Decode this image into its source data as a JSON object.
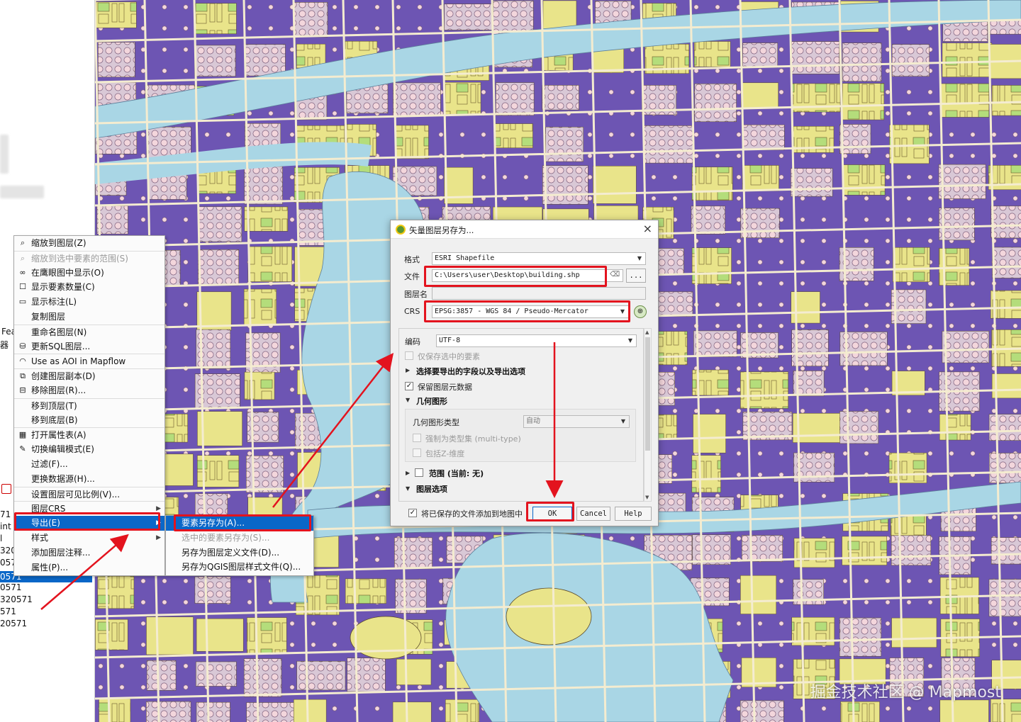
{
  "left_panel": {
    "fragments": [
      "Fea",
      "器",
      "71",
      "int",
      "l",
      "320",
      "0571",
      "0571",
      "0571",
      "320571",
      "571",
      "20571"
    ]
  },
  "context_menu": {
    "items": [
      {
        "label": "缩放到图层(Z)",
        "icon": "magnifier-icon",
        "disabled": false
      },
      {
        "label": "缩放到选中要素的范围(S)",
        "icon": "magnifier-icon",
        "disabled": true
      },
      {
        "label": "在鹰眼图中显示(O)",
        "icon": "binoculars-icon",
        "disabled": false
      },
      {
        "label": "显示要素数量(C)",
        "icon": "checkbox-icon",
        "disabled": false
      },
      {
        "label": "显示标注(L)",
        "icon": "label-icon",
        "disabled": false
      },
      {
        "label": "复制图层",
        "icon": "",
        "disabled": false
      },
      {
        "label": "重命名图层(N)",
        "icon": "",
        "disabled": false
      },
      {
        "label": "更新SQL图层...",
        "icon": "database-icon",
        "disabled": false
      },
      {
        "label": "Use as AOI in Mapflow",
        "icon": "mapflow-icon",
        "disabled": false
      },
      {
        "label": "创建图层副本(D)",
        "icon": "duplicate-icon",
        "disabled": false
      },
      {
        "label": "移除图层(R)...",
        "icon": "remove-layer-icon",
        "disabled": false
      },
      {
        "label": "移到顶层(T)",
        "icon": "",
        "disabled": false
      },
      {
        "label": "移到底层(B)",
        "icon": "",
        "disabled": false
      },
      {
        "label": "打开属性表(A)",
        "icon": "table-icon",
        "disabled": false
      },
      {
        "label": "切换编辑模式(E)",
        "icon": "pencil-icon",
        "disabled": false
      },
      {
        "label": "过滤(F)...",
        "icon": "",
        "disabled": false
      },
      {
        "label": "更换数据源(H)...",
        "icon": "",
        "disabled": false
      },
      {
        "label": "设置图层可见比例(V)...",
        "icon": "",
        "disabled": false
      },
      {
        "label": "图层CRS",
        "icon": "",
        "disabled": false,
        "submenu": true
      },
      {
        "label": "导出(E)",
        "icon": "",
        "disabled": false,
        "submenu": true,
        "highlighted": true
      },
      {
        "label": "样式",
        "icon": "",
        "disabled": false,
        "submenu": true
      },
      {
        "label": "添加图层注释...",
        "icon": "",
        "disabled": false
      },
      {
        "label": "属性(P)...",
        "icon": "",
        "disabled": false
      }
    ]
  },
  "export_submenu": {
    "items": [
      {
        "label": "要素另存为(A)...",
        "highlighted": true,
        "disabled": false
      },
      {
        "label": "选中的要素另存为(S)...",
        "highlighted": false,
        "disabled": true
      },
      {
        "label": "另存为图层定义文件(D)...",
        "highlighted": false,
        "disabled": false
      },
      {
        "label": "另存为QGIS图层样式文件(Q)...",
        "highlighted": false,
        "disabled": false
      }
    ]
  },
  "dialog": {
    "title": "矢量图层另存为...",
    "close": "×",
    "format_label": "格式",
    "format_value": "ESRI Shapefile",
    "file_label": "文件",
    "file_value": "C:\\Users\\user\\Desktop\\building.shp",
    "browse_label": "...",
    "layer_name_label": "图层名",
    "layer_name_value": "",
    "crs_label": "CRS",
    "crs_value": "EPSG:3857 - WGS 84 / Pseudo-Mercator",
    "encoding_label": "编码",
    "encoding_value": "UTF-8",
    "only_selected_label": "仅保存选中的要素",
    "fields_section": "选择要导出的字段以及导出选项",
    "persist_metadata_label": "保留图层元数据",
    "geometry_section": "几何图形",
    "geometry_type_label": "几何图形类型",
    "geometry_type_value": "自动",
    "force_multi_label": "强制为类型集 (multi-type)",
    "include_z_label": "包括Z-维度",
    "extent_section": "范围 (当前: 无)",
    "layer_options_section": "图层选项",
    "add_to_map_label": "将已保存的文件添加到地图中",
    "ok_label": "OK",
    "cancel_label": "Cancel",
    "help_label": "Help"
  },
  "map": {
    "watermark": "掘金技术社区 @ Mapmost",
    "colors": {
      "landuse_purple": "#6d55b3",
      "block_yellow": "#e9e48a",
      "water_blue": "#a9d6e5",
      "green_area": "#b4dd7b",
      "point_pink": "#f3d6dc",
      "annotation_red": "#e3131e"
    }
  }
}
